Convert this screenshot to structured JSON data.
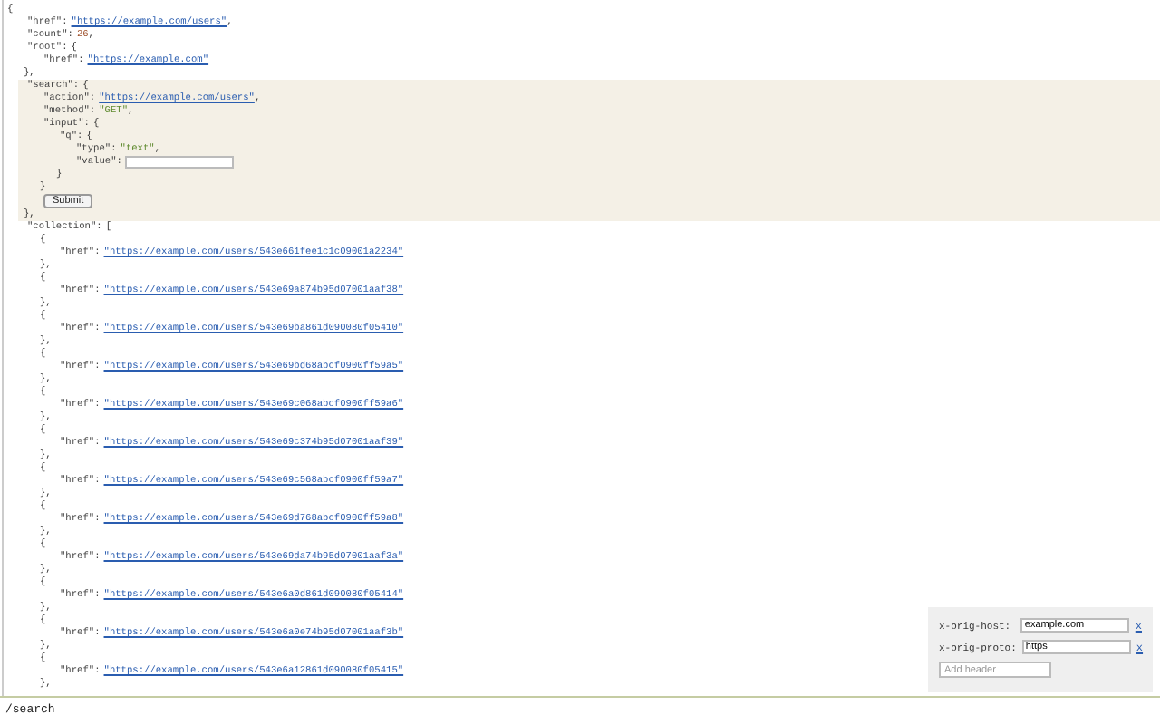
{
  "document": {
    "open": "{",
    "children": [
      {
        "key": "\"href\":",
        "kind": "link",
        "value": "\"https://example.com/users\"",
        "end": ","
      },
      {
        "key": "\"count\":",
        "kind": "number",
        "value": "26",
        "end": ","
      },
      {
        "key": "\"root\":",
        "open": "{",
        "children": [
          {
            "key": "\"href\":",
            "kind": "link",
            "value": "\"https://example.com\""
          }
        ],
        "close": "},"
      },
      {
        "key": "\"search\":",
        "open": "{",
        "shaded": true,
        "children": [
          {
            "key": "\"action\":",
            "kind": "link",
            "value": "\"https://example.com/users\"",
            "end": ","
          },
          {
            "key": "\"method\":",
            "kind": "string",
            "value": "\"GET\"",
            "end": ","
          },
          {
            "key": "\"input\":",
            "open": "{",
            "children": [
              {
                "key": "\"q\":",
                "open": "{",
                "children": [
                  {
                    "key": "\"type\":",
                    "kind": "string",
                    "value": "\"text\"",
                    "end": ","
                  },
                  {
                    "key": "\"value\":",
                    "kind": "field"
                  }
                ],
                "close": "}"
              }
            ],
            "close": "}"
          },
          {
            "kind": "button",
            "value": "Submit"
          }
        ],
        "close": "},"
      },
      {
        "key": "\"collection\":",
        "open": "[",
        "children": [
          {
            "open": "{",
            "children": [
              {
                "key": "\"href\":",
                "kind": "link",
                "value": "\"https://example.com/users/543e661fee1c1c09001a2234\""
              }
            ],
            "close": "},"
          },
          {
            "open": "{",
            "children": [
              {
                "key": "\"href\":",
                "kind": "link",
                "value": "\"https://example.com/users/543e69a874b95d07001aaf38\""
              }
            ],
            "close": "},"
          },
          {
            "open": "{",
            "children": [
              {
                "key": "\"href\":",
                "kind": "link",
                "value": "\"https://example.com/users/543e69ba861d090080f05410\""
              }
            ],
            "close": "},"
          },
          {
            "open": "{",
            "children": [
              {
                "key": "\"href\":",
                "kind": "link",
                "value": "\"https://example.com/users/543e69bd68abcf0900ff59a5\""
              }
            ],
            "close": "},"
          },
          {
            "open": "{",
            "children": [
              {
                "key": "\"href\":",
                "kind": "link",
                "value": "\"https://example.com/users/543e69c068abcf0900ff59a6\""
              }
            ],
            "close": "},"
          },
          {
            "open": "{",
            "children": [
              {
                "key": "\"href\":",
                "kind": "link",
                "value": "\"https://example.com/users/543e69c374b95d07001aaf39\""
              }
            ],
            "close": "},"
          },
          {
            "open": "{",
            "children": [
              {
                "key": "\"href\":",
                "kind": "link",
                "value": "\"https://example.com/users/543e69c568abcf0900ff59a7\""
              }
            ],
            "close": "},"
          },
          {
            "open": "{",
            "children": [
              {
                "key": "\"href\":",
                "kind": "link",
                "value": "\"https://example.com/users/543e69d768abcf0900ff59a8\""
              }
            ],
            "close": "},"
          },
          {
            "open": "{",
            "children": [
              {
                "key": "\"href\":",
                "kind": "link",
                "value": "\"https://example.com/users/543e69da74b95d07001aaf3a\""
              }
            ],
            "close": "},"
          },
          {
            "open": "{",
            "children": [
              {
                "key": "\"href\":",
                "kind": "link",
                "value": "\"https://example.com/users/543e6a0d861d090080f05414\""
              }
            ],
            "close": "},"
          },
          {
            "open": "{",
            "children": [
              {
                "key": "\"href\":",
                "kind": "link",
                "value": "\"https://example.com/users/543e6a0e74b95d07001aaf3b\""
              }
            ],
            "close": "},"
          },
          {
            "open": "{",
            "children": [
              {
                "key": "\"href\":",
                "kind": "link",
                "value": "\"https://example.com/users/543e6a12861d090080f05415\""
              }
            ],
            "close": "},"
          }
        ]
      }
    ]
  },
  "headers_panel": {
    "headers": [
      {
        "name": "x-orig-host:",
        "value": "example.com",
        "remove": "x"
      },
      {
        "name": "x-orig-proto:",
        "value": "https",
        "remove": "x"
      }
    ],
    "add_placeholder": "Add header"
  },
  "status_bar": {
    "path": "/search"
  }
}
